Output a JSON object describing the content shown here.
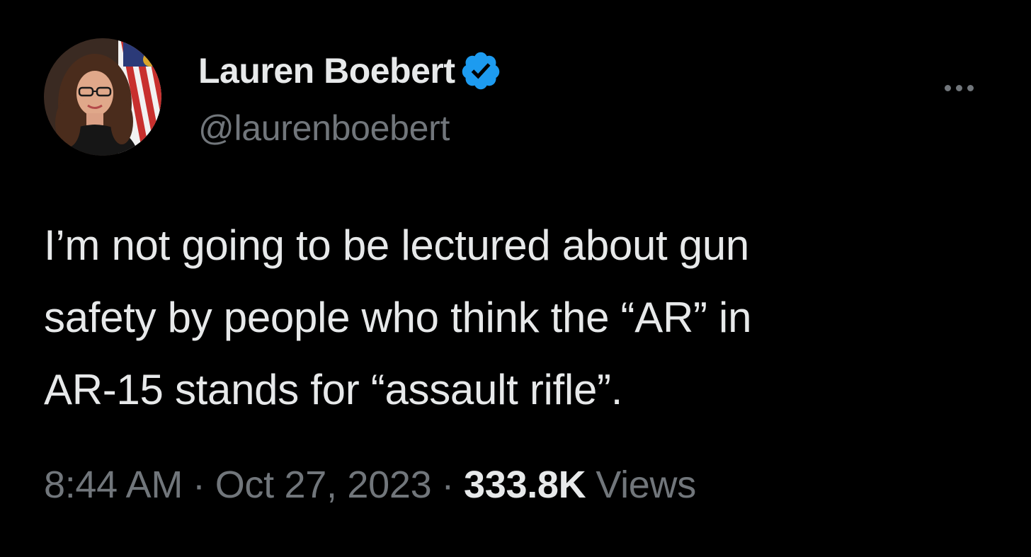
{
  "author": {
    "display_name": "Lauren Boebert",
    "handle": "@laurenboebert",
    "verified": true
  },
  "tweet": {
    "lines": [
      "I’m not going to be lectured about gun",
      "safety by people who think the “AR” in",
      "AR-15 stands for “assault rifle”."
    ]
  },
  "meta": {
    "time": "8:44 AM",
    "separator": "·",
    "date": "Oct 27, 2023",
    "views_count": "333.8K",
    "views_label": "Views"
  },
  "colors": {
    "background": "#000000",
    "primary_text": "#e7e9ea",
    "secondary_text": "#71767b",
    "verified_badge": "#1d9bf0"
  },
  "icons": {
    "verified": "verified-badge-icon",
    "more": "more-options-icon"
  }
}
